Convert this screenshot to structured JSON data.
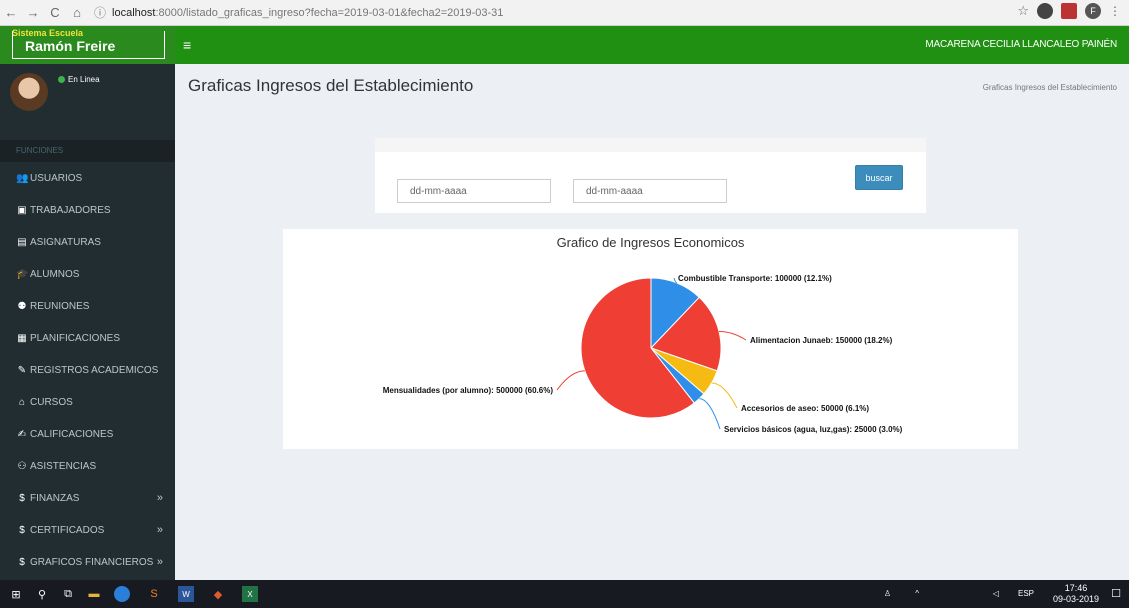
{
  "browser": {
    "url_host": "localhost",
    "url_path": ":8000/listado_graficas_ingreso?fecha=2019-03-01&fecha2=2019-03-31"
  },
  "header": {
    "logo_small": "Sistema Escuela",
    "logo_big": "Ramón Freire",
    "user_name": "MACARENA CECILIA LLANCALEO PAINÉN"
  },
  "sidebar": {
    "status": "En Linea",
    "section": "FUNCIONES",
    "items": [
      {
        "icon": "users-icon",
        "glyph": "👥",
        "label": "USUARIOS",
        "expandable": false
      },
      {
        "icon": "id-card-icon",
        "glyph": "▣",
        "label": "TRABAJADORES",
        "expandable": false
      },
      {
        "icon": "list-icon",
        "glyph": "▤",
        "label": "ASIGNATURAS",
        "expandable": false
      },
      {
        "icon": "graduation-cap-icon",
        "glyph": "🎓",
        "label": "ALUMNOS",
        "expandable": false
      },
      {
        "icon": "group-icon",
        "glyph": "⚉",
        "label": "REUNIONES",
        "expandable": false
      },
      {
        "icon": "copy-icon",
        "glyph": "▦",
        "label": "PLANIFICACIONES",
        "expandable": false
      },
      {
        "icon": "pencil-icon",
        "glyph": "✎",
        "label": "REGISTROS ACADEMICOS",
        "expandable": false
      },
      {
        "icon": "building-icon",
        "glyph": "⌂",
        "label": "CURSOS",
        "expandable": false
      },
      {
        "icon": "check-edit-icon",
        "glyph": "✍",
        "label": "CALIFICACIONES",
        "expandable": false
      },
      {
        "icon": "user-edit-icon",
        "glyph": "⚇",
        "label": "ASISTENCIAS",
        "expandable": false
      },
      {
        "icon": "dollar-icon",
        "glyph": "$",
        "label": "FINANZAS",
        "expandable": true
      },
      {
        "icon": "dollar-icon",
        "glyph": "$",
        "label": "CERTIFICADOS",
        "expandable": true
      },
      {
        "icon": "dollar-icon",
        "glyph": "$",
        "label": "GRAFICOS FINANCIEROS",
        "expandable": true
      }
    ]
  },
  "main": {
    "title": "Graficas Ingresos del Establecimiento",
    "breadcrumb": "Graficas Ingresos del Establecimiento",
    "search": {
      "date1_placeholder": "dd-mm-aaaa",
      "date2_placeholder": "dd-mm-aaaa",
      "button": "buscar"
    }
  },
  "chart_data": {
    "type": "pie",
    "title": "Grafico de Ingresos Economicos",
    "slices": [
      {
        "name": "Combustible Transporte",
        "value": 100000,
        "percent": 12.1,
        "label": "Combustible Transporte: 100000 (12.1%)",
        "color": "#2f8fe8"
      },
      {
        "name": "Alimentacion Junaeb",
        "value": 150000,
        "percent": 18.2,
        "label": "Alimentacion Junaeb: 150000 (18.2%)",
        "color": "#ef3f35"
      },
      {
        "name": "Accesorios de aseo",
        "value": 50000,
        "percent": 6.1,
        "label": "Accesorios de aseo: 50000 (6.1%)",
        "color": "#f6bb12"
      },
      {
        "name": "Servicios básicos (agua, luz,gas)",
        "value": 25000,
        "percent": 3.0,
        "label": "Servicios básicos (agua, luz,gas): 25000 (3.0%)",
        "color": "#2f8fe8"
      },
      {
        "name": "Mensualidades (por alumno)",
        "value": 500000,
        "percent": 60.6,
        "label": "Mensualidades (por alumno): 500000 (60.6%)",
        "color": "#ef3f35"
      }
    ]
  },
  "taskbar": {
    "lang": "ESP",
    "time": "17:46",
    "date": "09-03-2019"
  }
}
